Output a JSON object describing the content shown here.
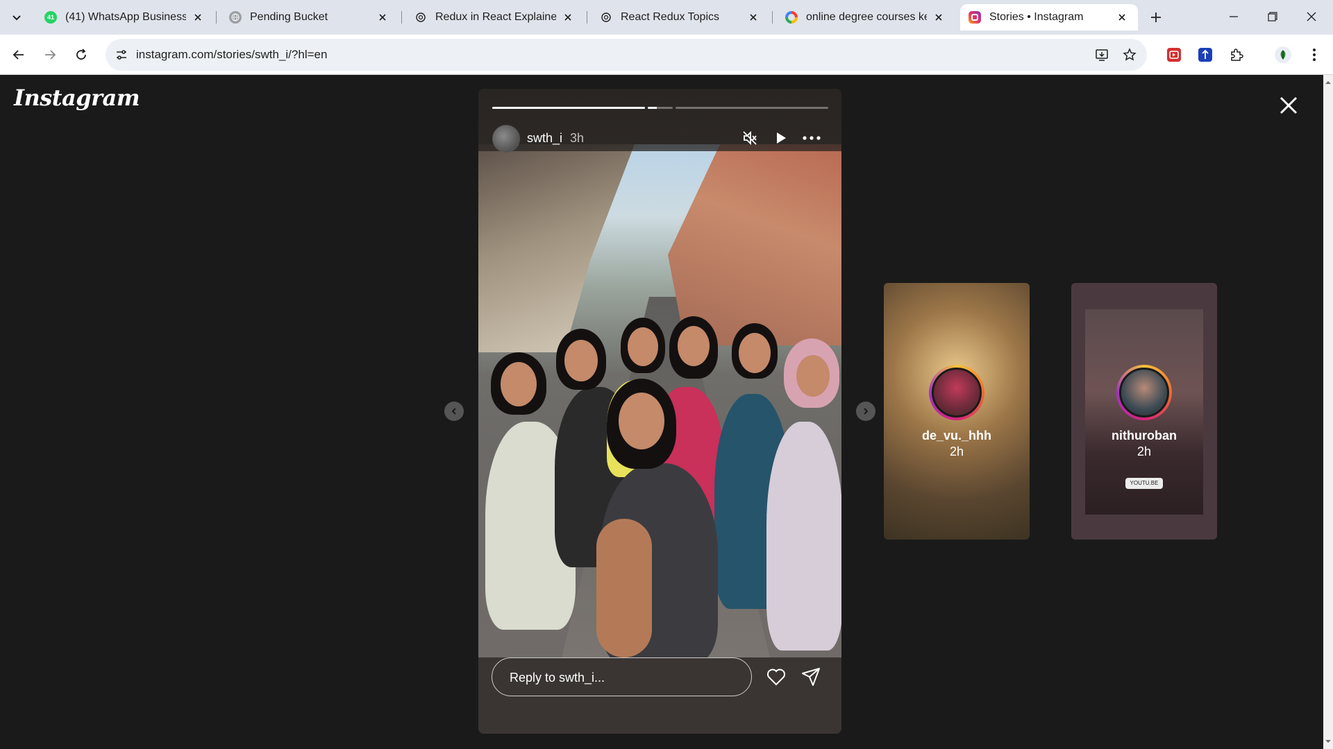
{
  "browser": {
    "tabs": [
      {
        "title": "(41) WhatsApp Business",
        "favicon": "whatsapp-icon",
        "favicon_badge": "41",
        "active": false
      },
      {
        "title": "Pending Bucket",
        "favicon": "globe-icon",
        "active": false
      },
      {
        "title": "Redux in React Explained",
        "favicon": "openai-icon",
        "active": false
      },
      {
        "title": "React Redux Topics",
        "favicon": "openai-icon",
        "active": false
      },
      {
        "title": "online degree courses kera",
        "favicon": "google-icon",
        "active": false
      },
      {
        "title": "Stories • Instagram",
        "favicon": "instagram-icon",
        "active": true
      }
    ],
    "url": "instagram.com/stories/swth_i/?hl=en"
  },
  "instagram": {
    "logo": "Instagram",
    "story": {
      "username": "swth_i",
      "time": "3h",
      "progress": [
        1.0,
        0.35,
        0.0
      ],
      "reply_placeholder": "Reply to swth_i..."
    },
    "previews": [
      {
        "username": "de_vu._hhh",
        "time": "2h"
      },
      {
        "username": "nithuroban",
        "time": "2h",
        "sticker": "YOUTU.BE"
      }
    ]
  },
  "colors": {
    "page_bg": "#1a1a1a",
    "story_bg": "#3a3533",
    "ring_gradient": [
      "#f7c33a",
      "#f16a2b",
      "#d6247a",
      "#a233c3"
    ]
  }
}
